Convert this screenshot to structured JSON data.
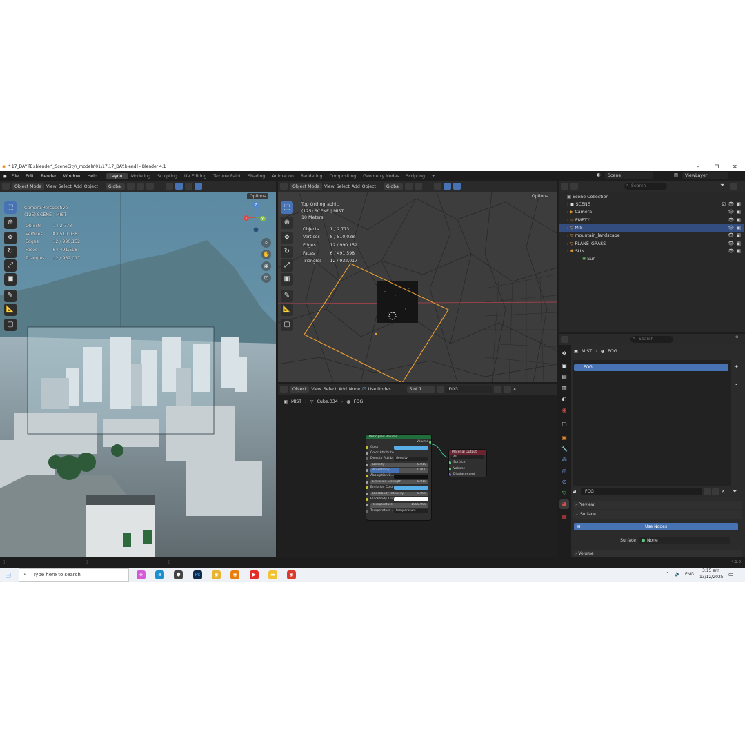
{
  "window": {
    "title": "* 17_DAY [E:\\blender\\_SceneCity\\_models\\01\\17\\17_DAY.blend] - Blender 4.1"
  },
  "menu": [
    "File",
    "Edit",
    "Render",
    "Window",
    "Help"
  ],
  "workspaces": [
    {
      "label": "Layout",
      "active": true
    },
    {
      "label": "Modeling"
    },
    {
      "label": "Sculpting"
    },
    {
      "label": "UV Editing"
    },
    {
      "label": "Texture Paint"
    },
    {
      "label": "Shading"
    },
    {
      "label": "Animation"
    },
    {
      "label": "Rendering"
    },
    {
      "label": "Compositing"
    },
    {
      "label": "Geometry Nodes"
    },
    {
      "label": "Scripting"
    }
  ],
  "topbar": {
    "scene": "Scene",
    "view_layer": "ViewLayer"
  },
  "viewport_left": {
    "mode": "Object Mode",
    "menus": [
      "View",
      "Select",
      "Add",
      "Object"
    ],
    "orientation": "Global",
    "options": "Options",
    "title": "Camera Perspective",
    "subtitle": "(125) SCENE | MIST",
    "stats": [
      [
        "Objects",
        "1 / 2,773"
      ],
      [
        "Vertices",
        "8 / 510,038"
      ],
      [
        "Edges",
        "12 / 990,152"
      ],
      [
        "Faces",
        "6 / 491,598"
      ],
      [
        "Triangles",
        "12 / 932,017"
      ]
    ],
    "axis": {
      "x": "X",
      "y": "Y",
      "z": "Z"
    }
  },
  "viewport_right": {
    "mode": "Object Mode",
    "menus": [
      "View",
      "Select",
      "Add",
      "Object"
    ],
    "orientation": "Global",
    "options": "Options",
    "title": "Top Orthographic",
    "subtitle": "(125) SCENE | MIST",
    "scale": "10 Meters",
    "stats": [
      [
        "Objects",
        "1 / 2,773"
      ],
      [
        "Vertices",
        "8 / 510,038"
      ],
      [
        "Edges",
        "12 / 990,152"
      ],
      [
        "Faces",
        "6 / 491,598"
      ],
      [
        "Triangles",
        "12 / 932,017"
      ]
    ]
  },
  "node_editor": {
    "type": "Object",
    "menus": [
      "View",
      "Select",
      "Add",
      "Node"
    ],
    "use_nodes": "Use Nodes",
    "slot": "Slot 1",
    "material": "FOG",
    "breadcrumb": [
      "MIST",
      "Cube.034",
      "FOG"
    ],
    "principled": {
      "title": "Principled Volume",
      "output": "Volume",
      "rows": [
        {
          "label": "Color",
          "kind": "swatch",
          "color": "#5aaee8"
        },
        {
          "label": "Color Attribute",
          "kind": "plain"
        },
        {
          "label": "Density Attrib...",
          "kind": "text",
          "value": "density"
        },
        {
          "label": "Density",
          "kind": "slider",
          "value": "0.010"
        },
        {
          "label": "Anisotropy",
          "kind": "slider",
          "value": "0.000",
          "fill": 0.5
        },
        {
          "label": "Absorption C...",
          "kind": "swatch",
          "color": "#111111"
        },
        {
          "label": "Emission Strength",
          "kind": "slider",
          "value": "0.010"
        },
        {
          "label": "Emission Color",
          "kind": "swatch",
          "color": "#5aaee8"
        },
        {
          "label": "Blackbody Intensity",
          "kind": "slider",
          "value": "0.000"
        },
        {
          "label": "Blackbody Tint",
          "kind": "swatch",
          "color": "#ffffff"
        },
        {
          "label": "Temperature",
          "kind": "slider",
          "value": "1000.000"
        },
        {
          "label": "Temperature ...",
          "kind": "text",
          "value": "temperature"
        }
      ]
    },
    "output": {
      "title": "Material Output",
      "target": "All",
      "sockets": [
        "Surface",
        "Volume",
        "Displacement"
      ]
    }
  },
  "outliner": {
    "search_placeholder": "Search",
    "root": "Scene Collection",
    "items": [
      {
        "label": "SCENE",
        "icon": "collection-icon",
        "checked": true
      },
      {
        "label": "Camera",
        "icon": "camera-icon"
      },
      {
        "label": "EMPTY",
        "icon": "empty-icon"
      },
      {
        "label": "MIST",
        "icon": "mesh-icon",
        "selected": true
      },
      {
        "label": "mountain_landscape",
        "icon": "mesh-icon"
      },
      {
        "label": "PLANE_GRASS",
        "icon": "mesh-icon"
      },
      {
        "label": "SUN",
        "icon": "light-icon"
      },
      {
        "label": "Sun",
        "icon": "light-data-icon",
        "child": true
      }
    ]
  },
  "properties": {
    "search_placeholder": "Search",
    "breadcrumb": [
      "MIST",
      "FOG"
    ],
    "material_slot": "FOG",
    "material_name": "FOG",
    "sections": {
      "preview": "Preview",
      "surface": "Surface",
      "volume": "Volume"
    },
    "use_nodes": "Use Nodes",
    "surface_label": "Surface",
    "surface_value": "None"
  },
  "statusbar": {
    "version": "4.1.0"
  },
  "taskbar": {
    "search_placeholder": "Type here to search",
    "lang": "ENG",
    "time": "3:15 am",
    "date": "13/12/2025"
  }
}
